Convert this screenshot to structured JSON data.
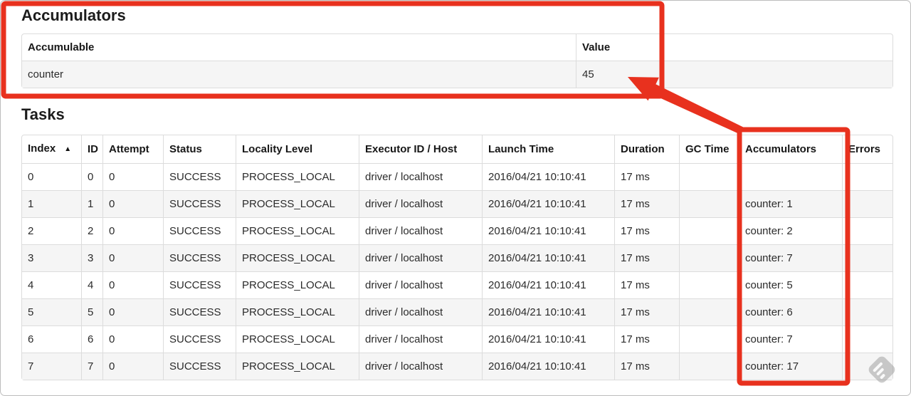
{
  "annotations": {
    "color": "#e8311e"
  },
  "accumulators_section": {
    "heading": "Accumulators",
    "table": {
      "headers": [
        "Accumulable",
        "Value"
      ],
      "rows": [
        {
          "accumulable": "counter",
          "value": "45"
        }
      ]
    }
  },
  "tasks_section": {
    "heading": "Tasks",
    "table": {
      "sort_indicator": "▲",
      "headers": [
        "Index",
        "ID",
        "Attempt",
        "Status",
        "Locality Level",
        "Executor ID / Host",
        "Launch Time",
        "Duration",
        "GC Time",
        "Accumulators",
        "Errors"
      ],
      "rows": [
        {
          "index": "0",
          "id": "0",
          "attempt": "0",
          "status": "SUCCESS",
          "locality_level": "PROCESS_LOCAL",
          "executor_id_host": "driver / localhost",
          "launch_time": "2016/04/21 10:10:41",
          "duration": "17 ms",
          "gc_time": "",
          "accumulators": "",
          "errors": ""
        },
        {
          "index": "1",
          "id": "1",
          "attempt": "0",
          "status": "SUCCESS",
          "locality_level": "PROCESS_LOCAL",
          "executor_id_host": "driver / localhost",
          "launch_time": "2016/04/21 10:10:41",
          "duration": "17 ms",
          "gc_time": "",
          "accumulators": "counter: 1",
          "errors": ""
        },
        {
          "index": "2",
          "id": "2",
          "attempt": "0",
          "status": "SUCCESS",
          "locality_level": "PROCESS_LOCAL",
          "executor_id_host": "driver / localhost",
          "launch_time": "2016/04/21 10:10:41",
          "duration": "17 ms",
          "gc_time": "",
          "accumulators": "counter: 2",
          "errors": ""
        },
        {
          "index": "3",
          "id": "3",
          "attempt": "0",
          "status": "SUCCESS",
          "locality_level": "PROCESS_LOCAL",
          "executor_id_host": "driver / localhost",
          "launch_time": "2016/04/21 10:10:41",
          "duration": "17 ms",
          "gc_time": "",
          "accumulators": "counter: 7",
          "errors": ""
        },
        {
          "index": "4",
          "id": "4",
          "attempt": "0",
          "status": "SUCCESS",
          "locality_level": "PROCESS_LOCAL",
          "executor_id_host": "driver / localhost",
          "launch_time": "2016/04/21 10:10:41",
          "duration": "17 ms",
          "gc_time": "",
          "accumulators": "counter: 5",
          "errors": ""
        },
        {
          "index": "5",
          "id": "5",
          "attempt": "0",
          "status": "SUCCESS",
          "locality_level": "PROCESS_LOCAL",
          "executor_id_host": "driver / localhost",
          "launch_time": "2016/04/21 10:10:41",
          "duration": "17 ms",
          "gc_time": "",
          "accumulators": "counter: 6",
          "errors": ""
        },
        {
          "index": "6",
          "id": "6",
          "attempt": "0",
          "status": "SUCCESS",
          "locality_level": "PROCESS_LOCAL",
          "executor_id_host": "driver / localhost",
          "launch_time": "2016/04/21 10:10:41",
          "duration": "17 ms",
          "gc_time": "",
          "accumulators": "counter: 7",
          "errors": ""
        },
        {
          "index": "7",
          "id": "7",
          "attempt": "0",
          "status": "SUCCESS",
          "locality_level": "PROCESS_LOCAL",
          "executor_id_host": "driver / localhost",
          "launch_time": "2016/04/21 10:10:41",
          "duration": "17 ms",
          "gc_time": "",
          "accumulators": "counter: 17",
          "errors": ""
        }
      ]
    }
  }
}
